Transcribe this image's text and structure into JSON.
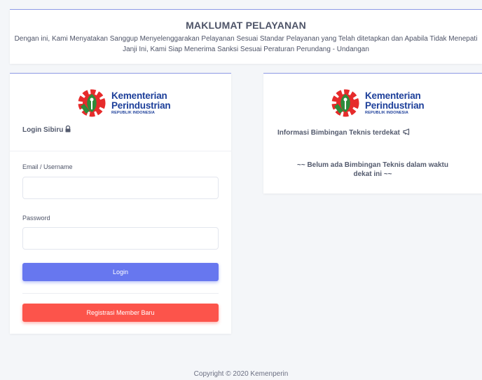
{
  "maklumat": {
    "title": "MAKLUMAT PELAYANAN",
    "text": "Dengan ini, Kami Menyatakan Sanggup Menyelenggarakan Pelayanan Sesuai Standar Pelayanan yang Telah ditetapkan dan Apabila Tidak Menepati Janji Ini, Kami Siap Menerima Sanksi Sesuai Peraturan Perundang - Undangan"
  },
  "logo": {
    "line1": "Kementerian",
    "line2": "Perindustrian",
    "line3": "REPUBLIK INDONESIA"
  },
  "login": {
    "title": "Login Sibiru",
    "email_label": "Email / Username",
    "email_value": "",
    "password_label": "Password",
    "password_value": "",
    "login_button": "Login",
    "register_button": "Registrasi Member Baru"
  },
  "info": {
    "title": "Informasi Bimbingan Teknis terdekat",
    "empty_text": "~~ Belum ada Bimbingan Teknis dalam waktu dekat ini ~~"
  },
  "footer": {
    "copyright": "Copyright © 2020 Kemenperin"
  },
  "colors": {
    "primary": "#6777ef",
    "danger": "#fc544b",
    "logo_red": "#e62b2b",
    "logo_green": "#2e8b3a",
    "logo_blue": "#1d3f9a"
  }
}
